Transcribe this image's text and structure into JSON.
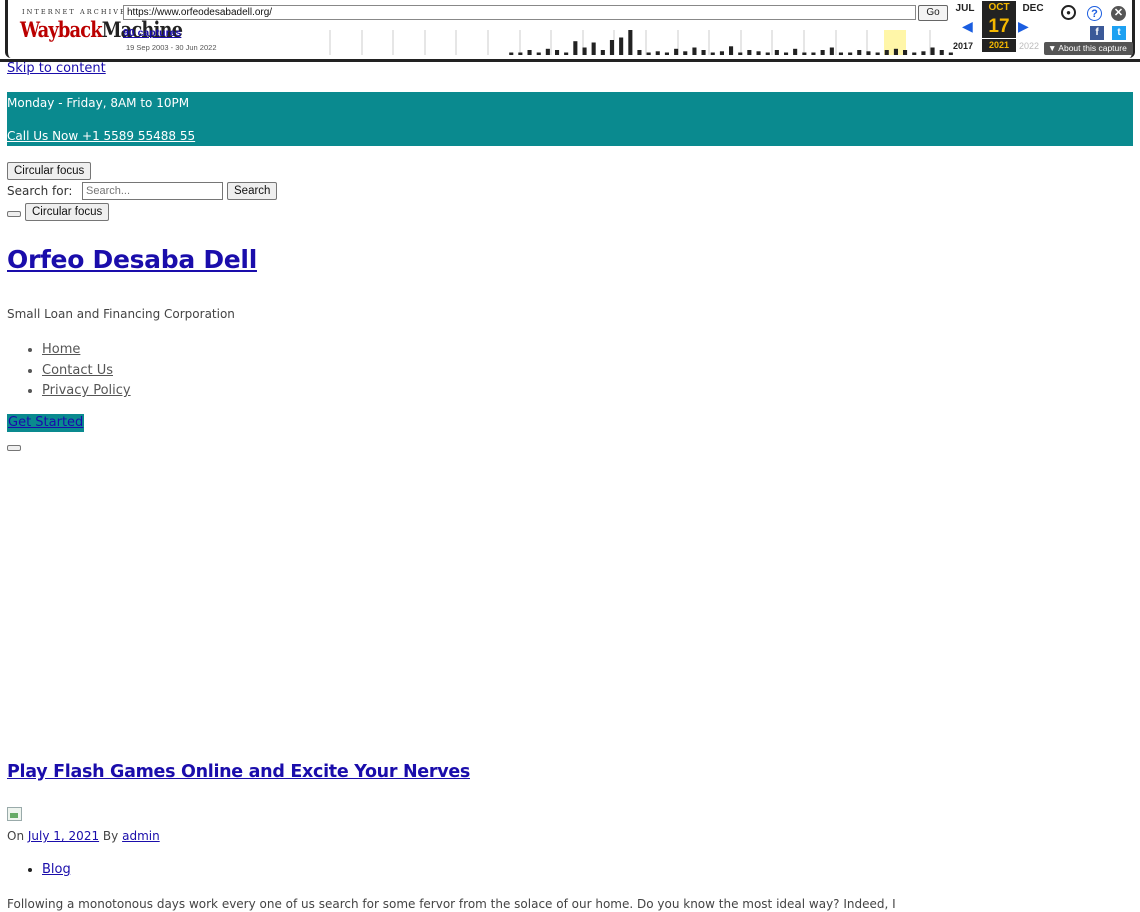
{
  "wayback": {
    "logo_top": "INTERNET ARCHIVE",
    "logo_wayback": "Wayback",
    "logo_machine": "Machine",
    "url": "https://www.orfeodesabadell.org/",
    "go_label": "Go",
    "captures": "90 captures",
    "date_range": "19 Sep 2003 - 30 Jun 2022",
    "months": {
      "prev": "JUL",
      "current": "OCT",
      "next": "DEC"
    },
    "day": "17",
    "years": {
      "prev": "2017",
      "current": "2021",
      "next": "2022"
    },
    "about_label": "▼ About this capture",
    "sparkline": [
      0,
      0,
      0,
      0,
      0,
      0,
      0,
      0,
      0,
      0,
      0,
      0,
      0,
      0,
      0,
      0,
      0,
      0,
      0,
      0,
      0.1,
      0.1,
      0.2,
      0.1,
      0.25,
      0.2,
      0.1,
      0.55,
      0.3,
      0.5,
      0.2,
      0.6,
      0.7,
      1.0,
      0.2,
      0.1,
      0.15,
      0.1,
      0.25,
      0.15,
      0.3,
      0.2,
      0.1,
      0.15,
      0.35,
      0.1,
      0.2,
      0.15,
      0.1,
      0.2,
      0.1,
      0.25,
      0.1,
      0.1,
      0.2,
      0.3,
      0.1,
      0.1,
      0.2,
      0.15,
      0.1,
      0.2,
      0.25,
      0.2,
      0.1,
      0.15,
      0.3,
      0.2,
      0.1
    ],
    "colors": {
      "accent": "#f5b800",
      "dark": "#222222",
      "link": "#1a5de0"
    }
  },
  "page": {
    "skip_link": "Skip to content",
    "topbar": {
      "hours": "Monday - Friday, 8AM to 10PM",
      "call": "Call Us Now +1 5589 55488 55",
      "color": "#0a8a8f"
    },
    "focus_button_1": "Circular focus",
    "search_label": "Search for:",
    "search_placeholder": "Search...",
    "search_button": "Search",
    "focus_button_2": "Circular focus",
    "site_title": "Orfeo Desaba Dell",
    "tagline": "Small Loan and Financing Corporation",
    "nav": [
      "Home",
      "Contact Us",
      "Privacy Policy"
    ],
    "cta": "Get Started",
    "post": {
      "title": "Play Flash Games Online and Excite Your Nerves",
      "meta_on": "On",
      "date": "July 1, 2021",
      "meta_by": "By",
      "author": "admin",
      "category": "Blog",
      "excerpt": "Following a monotonous days work every one of us search for some fervor from the solace of our home. Do you know the most ideal way? Indeed, I"
    }
  }
}
